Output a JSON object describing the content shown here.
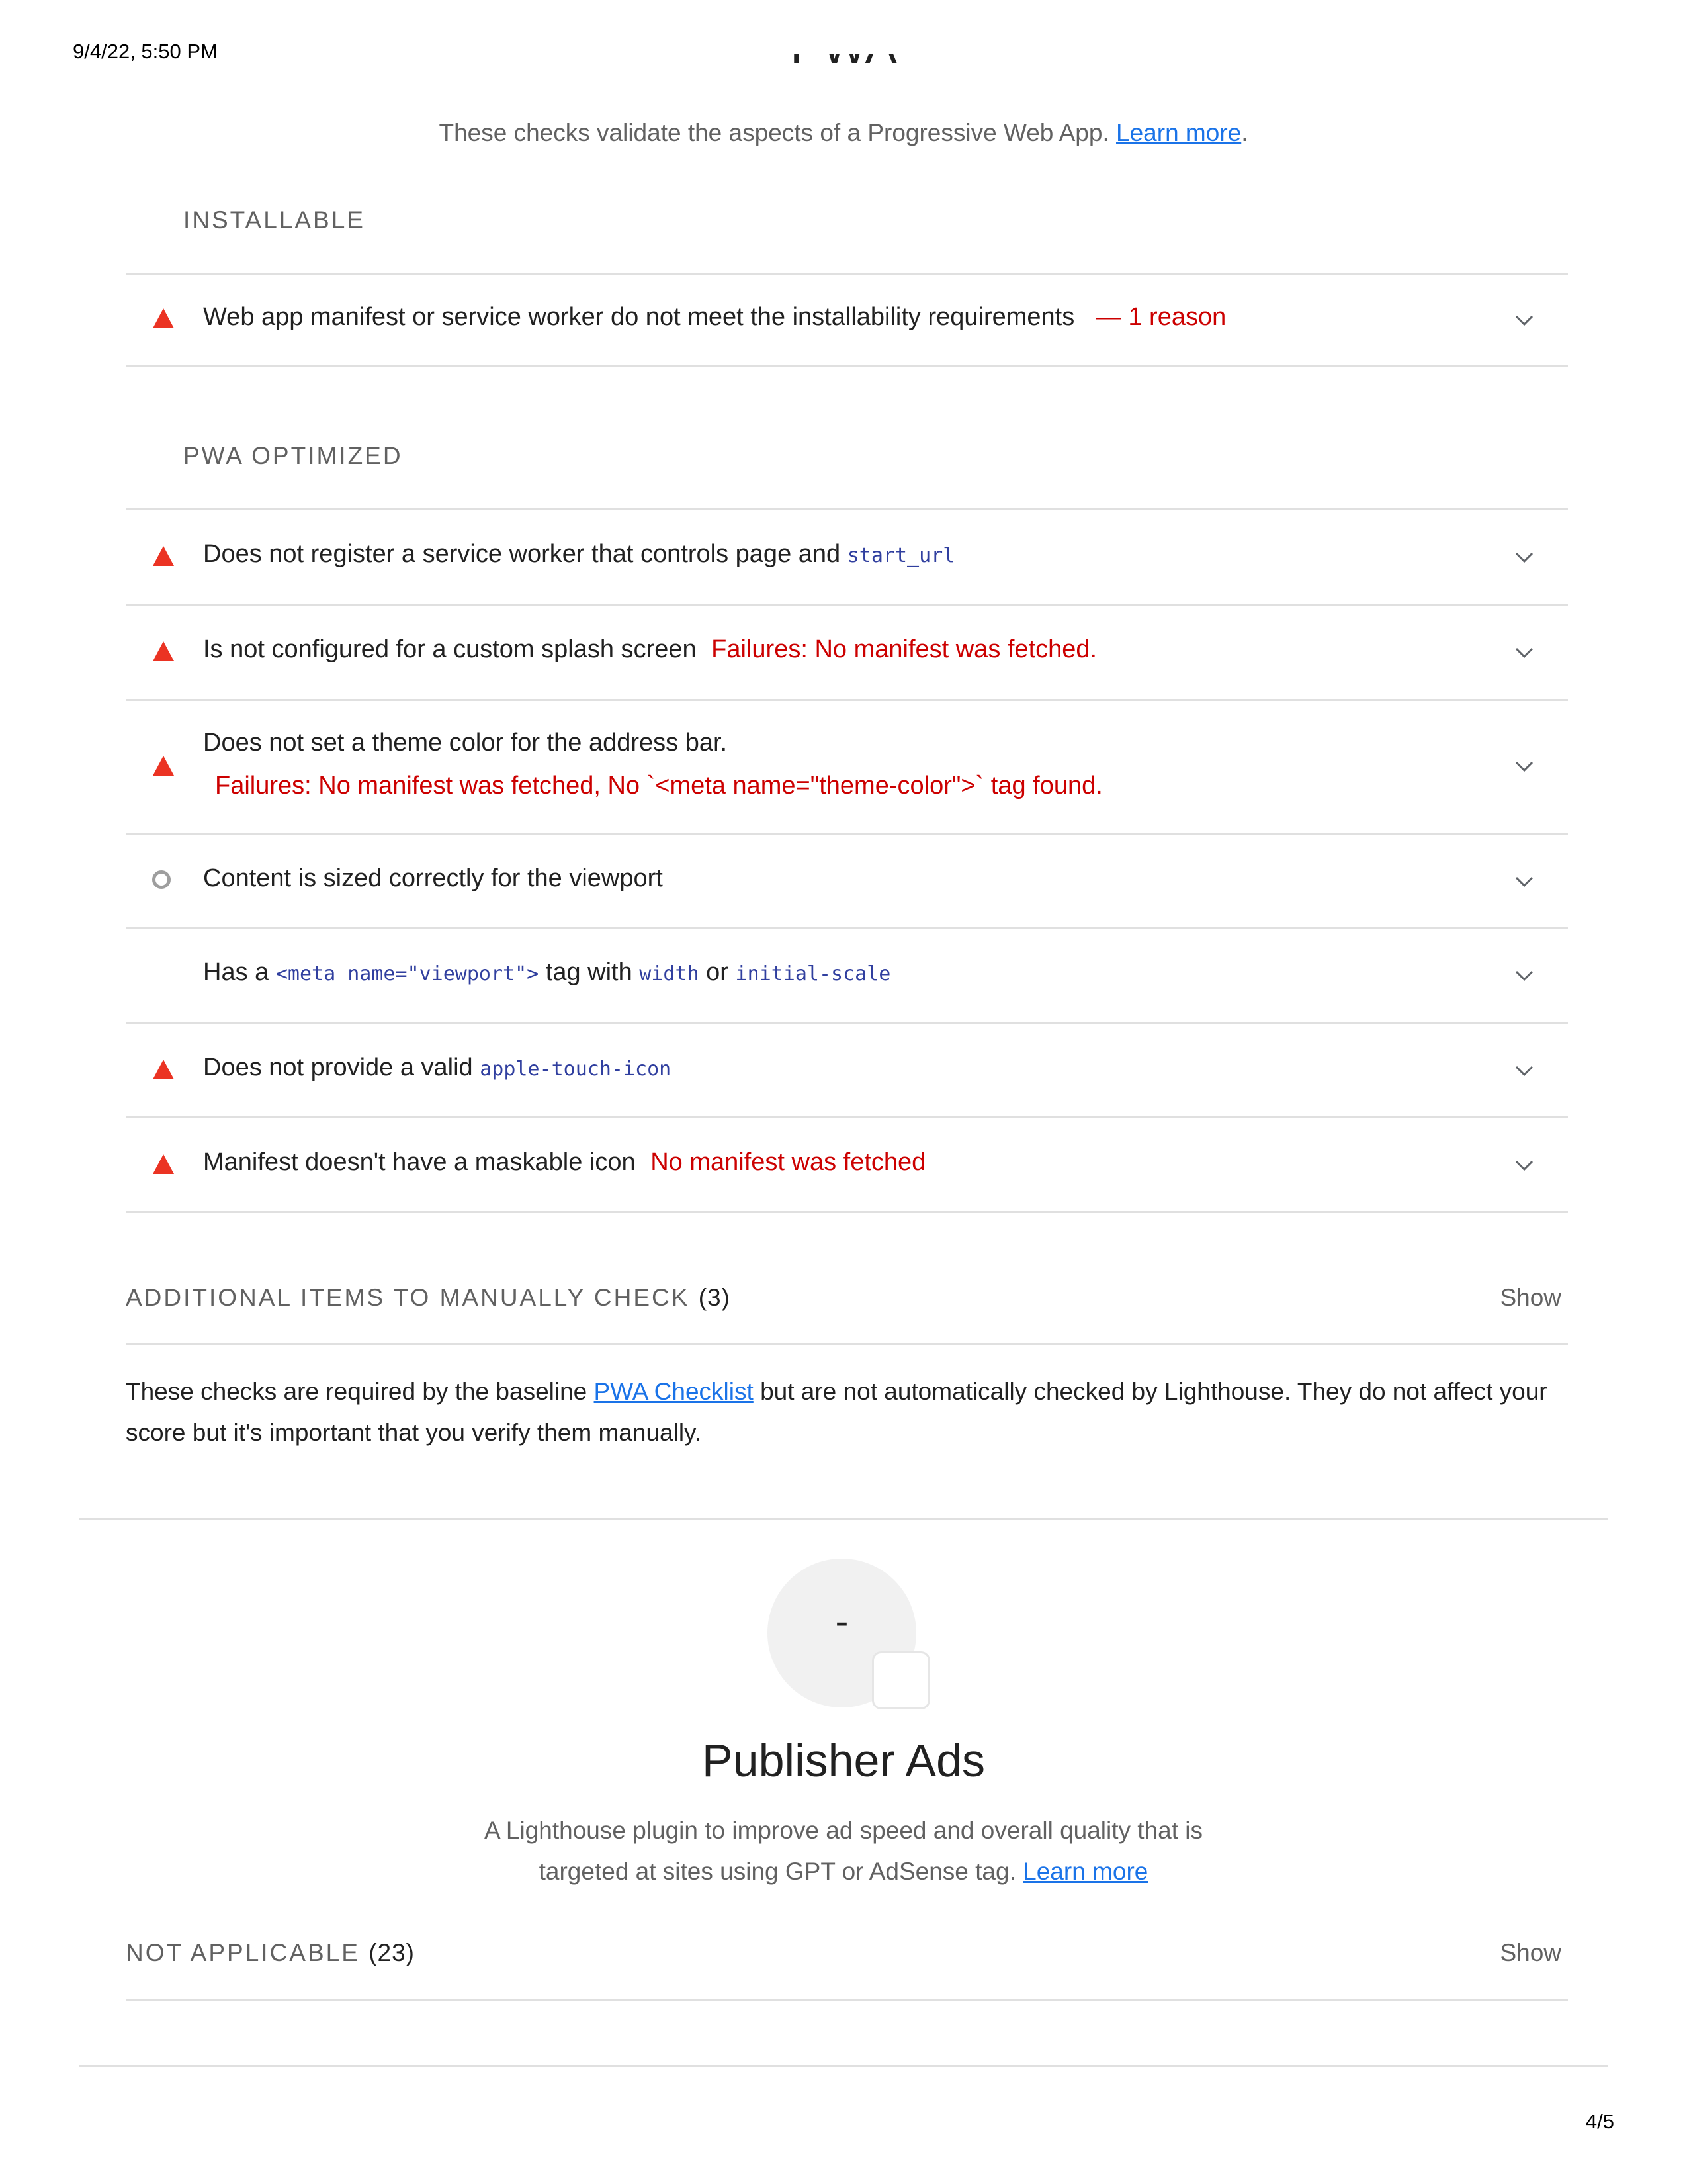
{
  "print_header": {
    "datetime": "9/4/22, 5:50 PM",
    "page": "4/5"
  },
  "pwa": {
    "title": "PWA",
    "description": "These checks validate the aspects of a Progressive Web App.",
    "learn_more": "Learn more",
    "period": "."
  },
  "installable": {
    "title": "INSTALLABLE",
    "audits": [
      {
        "status": "fail",
        "icon": "warning-triangle-icon",
        "title": "Web app manifest or service worker do not meet the installability requirements",
        "detail": "— 1 reason"
      }
    ]
  },
  "optimized": {
    "title": "PWA OPTIMIZED",
    "audits": [
      {
        "status": "fail",
        "icon": "warning-triangle-icon",
        "title_prefix": "Does not register a service worker that controls page and",
        "code": "start_url"
      },
      {
        "status": "fail",
        "icon": "warning-triangle-icon",
        "title": "Is not configured for a custom splash screen",
        "detail": "Failures: No manifest was fetched."
      },
      {
        "status": "fail",
        "icon": "warning-triangle-icon",
        "title": "Does not set a theme color for the address bar.",
        "detail": "Failures: No manifest was fetched, No `<meta name=\"theme-color\">` tag found."
      },
      {
        "status": "pass",
        "icon": "circle-pass-icon",
        "title": "Content is sized correctly for the viewport"
      },
      {
        "status": "pass",
        "icon": "none",
        "title_parts": [
          "Has a",
          "<meta name=\"viewport\">",
          "tag with",
          "width",
          "or",
          "initial-scale"
        ]
      },
      {
        "status": "fail",
        "icon": "warning-triangle-icon",
        "title_prefix": "Does not provide a valid",
        "code": "apple-touch-icon"
      },
      {
        "status": "fail",
        "icon": "warning-triangle-icon",
        "title": "Manifest doesn't have a maskable icon",
        "detail": "No manifest was fetched"
      }
    ]
  },
  "manual": {
    "title": "ADDITIONAL ITEMS TO MANUALLY CHECK",
    "count": "(3)",
    "show": "Show",
    "desc_before": "These checks are required by the baseline",
    "desc_link": "PWA Checklist",
    "desc_after": "but are not automatically checked by Lighthouse. They do not affect your score but it's important that you verify them manually."
  },
  "publisher_ads": {
    "score": "-",
    "title": "Publisher Ads",
    "desc_line1": "A Lighthouse plugin to improve ad speed and overall quality that is",
    "desc_line2": "targeted at sites using GPT or AdSense tag.",
    "learn_more": "Learn more"
  },
  "not_applicable": {
    "title": "NOT APPLICABLE",
    "count": "(23)",
    "show": "Show"
  },
  "colors": {
    "fail": "#eb3323",
    "fail_text": "#cc0000",
    "link": "#1a73e8",
    "code": "#303f9f",
    "muted": "#616161",
    "rule": "#e0e0e0"
  }
}
